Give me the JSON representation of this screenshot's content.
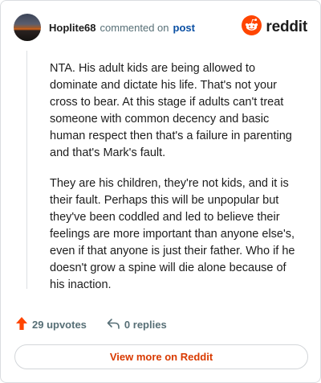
{
  "header": {
    "username": "Hoplite68",
    "action_text": "commented on",
    "post_link": "post",
    "logo_text": "reddit"
  },
  "comment": {
    "paragraphs": [
      "NTA. His adult kids are being allowed to dominate and dictate his life. That's not your cross to bear. At this stage if adults can't treat someone with common decency and basic human respect then that's a failure in parenting and that's Mark's fault.",
      "They are his children, they're not kids, and it is their fault. Perhaps this will be unpopular but they've been coddled and led to believe their feelings are more important than anyone else's, even if that anyone is just their father. Who if he doesn't grow a spine will die alone because of his inaction."
    ]
  },
  "actions": {
    "upvotes_label": "29 upvotes",
    "replies_label": "0 replies"
  },
  "footer": {
    "view_more_label": "View more on Reddit"
  },
  "colors": {
    "accent": "#d93a00",
    "reddit_orange": "#ff4500",
    "link": "#0a4fa3",
    "muted": "#576f76"
  },
  "icons": {
    "logo": "reddit-snoo-icon",
    "upvote": "upvote-arrow-icon",
    "reply": "reply-arrow-icon"
  }
}
